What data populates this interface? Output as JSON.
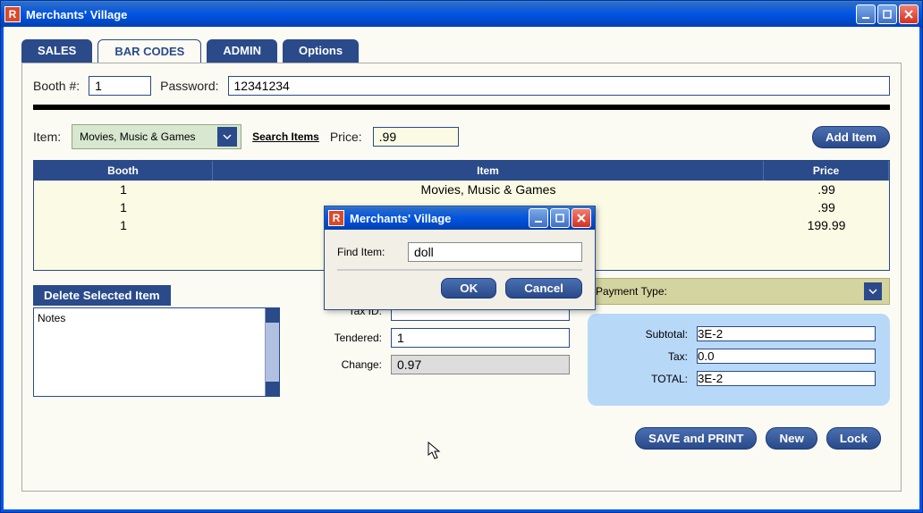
{
  "window": {
    "title": "Merchants' Village",
    "icon_letter": "R"
  },
  "tabs": [
    "SALES",
    "BAR CODES",
    "ADMIN",
    "Options"
  ],
  "active_tab": 1,
  "form": {
    "booth_label": "Booth #:",
    "booth_value": "1",
    "password_label": "Password:",
    "password_value": "12341234",
    "item_label": "Item:",
    "item_dropdown": "Movies, Music & Games",
    "search_items": "Search Items",
    "price_label": "Price:",
    "price_value": ".99",
    "add_item": "Add Item"
  },
  "table": {
    "headers": [
      "Booth",
      "Item",
      "Price"
    ],
    "rows": [
      {
        "booth": "1",
        "item": "Movies, Music & Games",
        "price": ".99"
      },
      {
        "booth": "1",
        "item": "",
        "price": ".99"
      },
      {
        "booth": "1",
        "item": "",
        "price": "199.99"
      }
    ]
  },
  "delete_button": "Delete Selected Item",
  "notes_label": "Notes",
  "center_fields": {
    "tax_id_label": "Tax ID:",
    "tax_id_value": "",
    "tendered_label": "Tendered:",
    "tendered_value": "1",
    "change_label": "Change:",
    "change_value": "0.97"
  },
  "payment_type_label": "Payment Type:",
  "totals": {
    "subtotal_label": "Subtotal:",
    "subtotal_value": "3E-2",
    "tax_label": "Tax:",
    "tax_value": "0.0",
    "total_label": "TOTAL:",
    "total_value": "3E-2"
  },
  "footer": {
    "save": "SAVE and PRINT",
    "new": "New",
    "lock": "Lock"
  },
  "dialog": {
    "title": "Merchants' Village",
    "find_label": "Find Item:",
    "find_value": "doll",
    "ok": "OK",
    "cancel": "Cancel"
  }
}
